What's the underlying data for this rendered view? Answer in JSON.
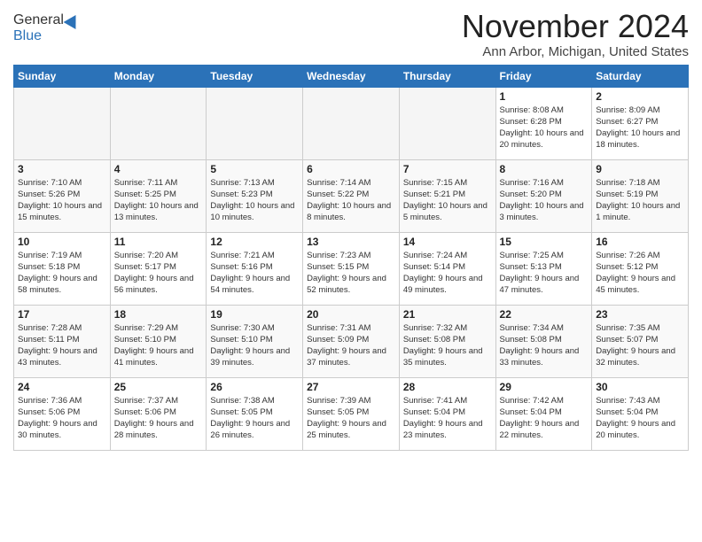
{
  "header": {
    "logo_general": "General",
    "logo_blue": "Blue",
    "month_title": "November 2024",
    "location": "Ann Arbor, Michigan, United States"
  },
  "weekdays": [
    "Sunday",
    "Monday",
    "Tuesday",
    "Wednesday",
    "Thursday",
    "Friday",
    "Saturday"
  ],
  "weeks": [
    [
      {
        "day": "",
        "info": ""
      },
      {
        "day": "",
        "info": ""
      },
      {
        "day": "",
        "info": ""
      },
      {
        "day": "",
        "info": ""
      },
      {
        "day": "",
        "info": ""
      },
      {
        "day": "1",
        "info": "Sunrise: 8:08 AM\nSunset: 6:28 PM\nDaylight: 10 hours and 20 minutes."
      },
      {
        "day": "2",
        "info": "Sunrise: 8:09 AM\nSunset: 6:27 PM\nDaylight: 10 hours and 18 minutes."
      }
    ],
    [
      {
        "day": "3",
        "info": "Sunrise: 7:10 AM\nSunset: 5:26 PM\nDaylight: 10 hours and 15 minutes."
      },
      {
        "day": "4",
        "info": "Sunrise: 7:11 AM\nSunset: 5:25 PM\nDaylight: 10 hours and 13 minutes."
      },
      {
        "day": "5",
        "info": "Sunrise: 7:13 AM\nSunset: 5:23 PM\nDaylight: 10 hours and 10 minutes."
      },
      {
        "day": "6",
        "info": "Sunrise: 7:14 AM\nSunset: 5:22 PM\nDaylight: 10 hours and 8 minutes."
      },
      {
        "day": "7",
        "info": "Sunrise: 7:15 AM\nSunset: 5:21 PM\nDaylight: 10 hours and 5 minutes."
      },
      {
        "day": "8",
        "info": "Sunrise: 7:16 AM\nSunset: 5:20 PM\nDaylight: 10 hours and 3 minutes."
      },
      {
        "day": "9",
        "info": "Sunrise: 7:18 AM\nSunset: 5:19 PM\nDaylight: 10 hours and 1 minute."
      }
    ],
    [
      {
        "day": "10",
        "info": "Sunrise: 7:19 AM\nSunset: 5:18 PM\nDaylight: 9 hours and 58 minutes."
      },
      {
        "day": "11",
        "info": "Sunrise: 7:20 AM\nSunset: 5:17 PM\nDaylight: 9 hours and 56 minutes."
      },
      {
        "day": "12",
        "info": "Sunrise: 7:21 AM\nSunset: 5:16 PM\nDaylight: 9 hours and 54 minutes."
      },
      {
        "day": "13",
        "info": "Sunrise: 7:23 AM\nSunset: 5:15 PM\nDaylight: 9 hours and 52 minutes."
      },
      {
        "day": "14",
        "info": "Sunrise: 7:24 AM\nSunset: 5:14 PM\nDaylight: 9 hours and 49 minutes."
      },
      {
        "day": "15",
        "info": "Sunrise: 7:25 AM\nSunset: 5:13 PM\nDaylight: 9 hours and 47 minutes."
      },
      {
        "day": "16",
        "info": "Sunrise: 7:26 AM\nSunset: 5:12 PM\nDaylight: 9 hours and 45 minutes."
      }
    ],
    [
      {
        "day": "17",
        "info": "Sunrise: 7:28 AM\nSunset: 5:11 PM\nDaylight: 9 hours and 43 minutes."
      },
      {
        "day": "18",
        "info": "Sunrise: 7:29 AM\nSunset: 5:10 PM\nDaylight: 9 hours and 41 minutes."
      },
      {
        "day": "19",
        "info": "Sunrise: 7:30 AM\nSunset: 5:10 PM\nDaylight: 9 hours and 39 minutes."
      },
      {
        "day": "20",
        "info": "Sunrise: 7:31 AM\nSunset: 5:09 PM\nDaylight: 9 hours and 37 minutes."
      },
      {
        "day": "21",
        "info": "Sunrise: 7:32 AM\nSunset: 5:08 PM\nDaylight: 9 hours and 35 minutes."
      },
      {
        "day": "22",
        "info": "Sunrise: 7:34 AM\nSunset: 5:08 PM\nDaylight: 9 hours and 33 minutes."
      },
      {
        "day": "23",
        "info": "Sunrise: 7:35 AM\nSunset: 5:07 PM\nDaylight: 9 hours and 32 minutes."
      }
    ],
    [
      {
        "day": "24",
        "info": "Sunrise: 7:36 AM\nSunset: 5:06 PM\nDaylight: 9 hours and 30 minutes."
      },
      {
        "day": "25",
        "info": "Sunrise: 7:37 AM\nSunset: 5:06 PM\nDaylight: 9 hours and 28 minutes."
      },
      {
        "day": "26",
        "info": "Sunrise: 7:38 AM\nSunset: 5:05 PM\nDaylight: 9 hours and 26 minutes."
      },
      {
        "day": "27",
        "info": "Sunrise: 7:39 AM\nSunset: 5:05 PM\nDaylight: 9 hours and 25 minutes."
      },
      {
        "day": "28",
        "info": "Sunrise: 7:41 AM\nSunset: 5:04 PM\nDaylight: 9 hours and 23 minutes."
      },
      {
        "day": "29",
        "info": "Sunrise: 7:42 AM\nSunset: 5:04 PM\nDaylight: 9 hours and 22 minutes."
      },
      {
        "day": "30",
        "info": "Sunrise: 7:43 AM\nSunset: 5:04 PM\nDaylight: 9 hours and 20 minutes."
      }
    ]
  ]
}
